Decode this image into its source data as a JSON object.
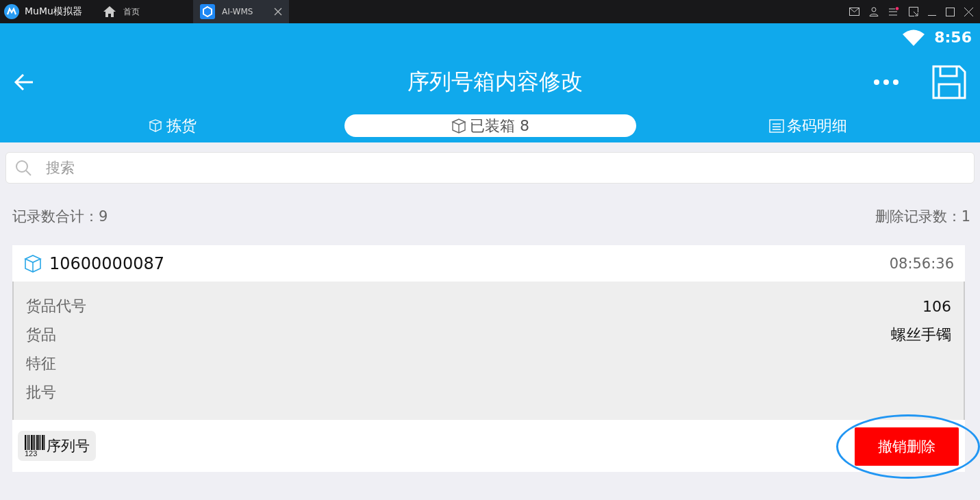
{
  "emulator": {
    "app_name": "MuMu模拟器",
    "tabs": [
      {
        "label": "首页",
        "kind": "home",
        "selected": false
      },
      {
        "label": "AI-WMS",
        "kind": "app",
        "selected": true
      }
    ]
  },
  "status_bar": {
    "time": "8:56"
  },
  "app_bar": {
    "title": "序列号箱内容修改"
  },
  "tabs": [
    {
      "label": "拣货",
      "kind": "boxes",
      "selected": false
    },
    {
      "label": "已装箱 8",
      "kind": "box",
      "selected": true
    },
    {
      "label": "条码明细",
      "kind": "list",
      "selected": false
    }
  ],
  "search": {
    "placeholder": "搜索"
  },
  "summary": {
    "total": "记录数合计：9",
    "deleted": "删除记录数：1"
  },
  "record": {
    "code": "10600000087",
    "time": "08:56:36",
    "fields": [
      {
        "label": "货品代号",
        "value": "106"
      },
      {
        "label": "货品",
        "value": "螺丝手镯"
      },
      {
        "label": "特征"
      },
      {
        "label": "批号"
      }
    ],
    "serial_chip": {
      "digits": "123",
      "label": "序列号"
    },
    "action": "撤销删除",
    "highlighted": true
  }
}
